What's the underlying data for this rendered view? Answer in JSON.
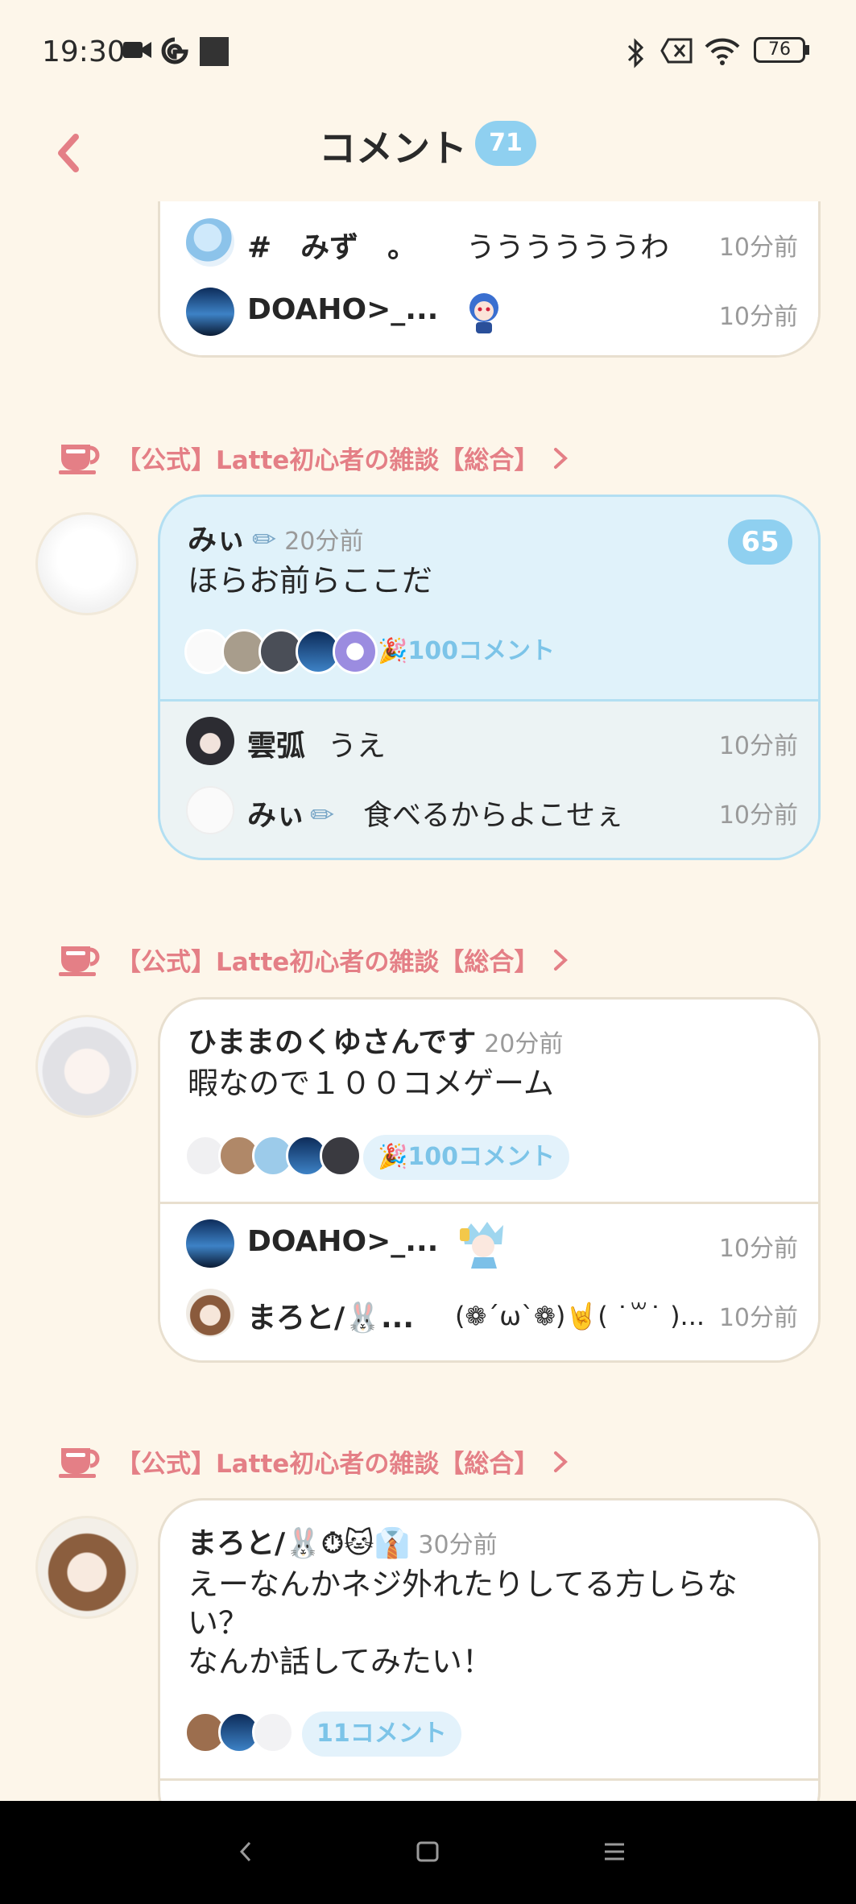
{
  "status_bar": {
    "time": "19:30",
    "battery": "76"
  },
  "header": {
    "title": "コメント",
    "count": "71"
  },
  "top_card": {
    "replies": [
      {
        "name": "#　みず　。",
        "text": "ううううううわ",
        "time": "10分前"
      },
      {
        "name": "DOAHO>_...",
        "text": "",
        "time": "10分前"
      }
    ]
  },
  "threads": [
    {
      "group": "【公式】Latte初心者の雑談【総合】",
      "author": "みぃ",
      "time": "20分前",
      "body": "ほらお前らここだ",
      "count": "65",
      "comments": "🎉100コメント",
      "replies": [
        {
          "name": "雲弧",
          "text": "うえ",
          "time": "10分前"
        },
        {
          "name": "みぃ",
          "text": "食べるからよこせぇ",
          "time": "10分前"
        }
      ]
    },
    {
      "group": "【公式】Latte初心者の雑談【総合】",
      "author": "ひままのくゆさんです",
      "time": "20分前",
      "body": "暇なので１００コメゲーム",
      "comments": "🎉100コメント",
      "replies": [
        {
          "name": "DOAHO>_...",
          "text": "",
          "time": "10分前"
        },
        {
          "name": "まろと/🐰...",
          "text": "(❁´ω`❁)🤘( ˙꒳​˙ )...",
          "time": "10分前"
        }
      ]
    },
    {
      "group": "【公式】Latte初心者の雑談【総合】",
      "author": "まろと/🐰⏱🐱👔",
      "time": "30分前",
      "body_lines": [
        "えーなんかネジ外れたりしてる方しらな",
        "い？",
        "なんか話してみたい！"
      ],
      "comments": "11コメント"
    }
  ],
  "colors": {
    "background": "#FDF6EA",
    "accent_blue": "#8FD0F0",
    "accent_pink": "#E47F86",
    "highlight": "#E0F2FA"
  }
}
